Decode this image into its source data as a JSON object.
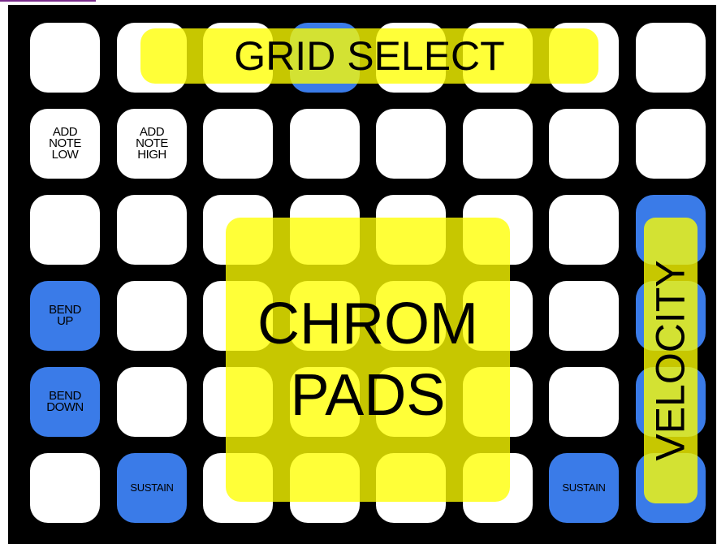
{
  "colors": {
    "background": "#000000",
    "pad_white": "#ffffff",
    "pad_blue": "#3a7be8",
    "overlay_yellow": "#ffff00"
  },
  "grid": {
    "rows": [
      [
        {
          "label": "",
          "color": "white"
        },
        {
          "label": "",
          "color": "white"
        },
        {
          "label": "",
          "color": "white"
        },
        {
          "label": "",
          "color": "blue"
        },
        {
          "label": "",
          "color": "white"
        },
        {
          "label": "",
          "color": "white"
        },
        {
          "label": "",
          "color": "white"
        },
        {
          "label": "",
          "color": "white"
        }
      ],
      [
        {
          "label": "ADD\nNOTE\nLOW",
          "color": "white"
        },
        {
          "label": "ADD\nNOTE\nHIGH",
          "color": "white"
        },
        {
          "label": "",
          "color": "white"
        },
        {
          "label": "",
          "color": "white"
        },
        {
          "label": "",
          "color": "white"
        },
        {
          "label": "",
          "color": "white"
        },
        {
          "label": "",
          "color": "white"
        },
        {
          "label": "",
          "color": "white"
        }
      ],
      [
        {
          "label": "",
          "color": "white"
        },
        {
          "label": "",
          "color": "white"
        },
        {
          "label": "",
          "color": "white"
        },
        {
          "label": "",
          "color": "white"
        },
        {
          "label": "",
          "color": "white"
        },
        {
          "label": "",
          "color": "white"
        },
        {
          "label": "",
          "color": "white"
        },
        {
          "label": "",
          "color": "blue"
        }
      ],
      [
        {
          "label": "BEND\nUP",
          "color": "blue"
        },
        {
          "label": "",
          "color": "white"
        },
        {
          "label": "",
          "color": "white"
        },
        {
          "label": "",
          "color": "white"
        },
        {
          "label": "",
          "color": "white"
        },
        {
          "label": "",
          "color": "white"
        },
        {
          "label": "",
          "color": "white"
        },
        {
          "label": "",
          "color": "blue"
        }
      ],
      [
        {
          "label": "BEND\nDOWN",
          "color": "blue"
        },
        {
          "label": "",
          "color": "white"
        },
        {
          "label": "",
          "color": "white"
        },
        {
          "label": "",
          "color": "white"
        },
        {
          "label": "",
          "color": "white"
        },
        {
          "label": "",
          "color": "white"
        },
        {
          "label": "",
          "color": "white"
        },
        {
          "label": "",
          "color": "blue"
        }
      ],
      [
        {
          "label": "",
          "color": "white"
        },
        {
          "label": "SUSTAIN",
          "color": "blue"
        },
        {
          "label": "",
          "color": "white"
        },
        {
          "label": "",
          "color": "white"
        },
        {
          "label": "",
          "color": "white"
        },
        {
          "label": "",
          "color": "white"
        },
        {
          "label": "SUSTAIN",
          "color": "blue"
        },
        {
          "label": "",
          "color": "blue"
        }
      ]
    ]
  },
  "overlays": {
    "grid_select": "GRID SELECT",
    "chrom_pads": "CHROM\nPADS",
    "velocity": "VELOCITY"
  }
}
